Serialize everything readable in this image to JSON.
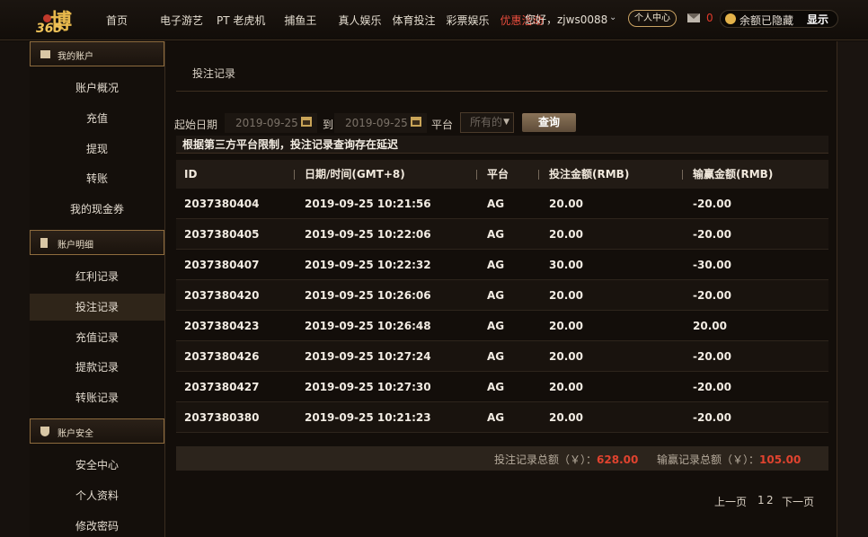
{
  "header": {
    "logo_text": "博",
    "logo_number": "365",
    "nav": [
      "首页",
      "电子游艺",
      "PT 老虎机",
      "捕鱼王",
      "真人娱乐",
      "体育投注",
      "彩票娱乐",
      "优惠活动"
    ],
    "greeting": "您好，zjws0088",
    "personal_center": "个人中心",
    "mail_count": "0",
    "balance_hidden": "余额已隐藏",
    "show_label": "显示"
  },
  "sidebar": {
    "sections": [
      {
        "title": "我的账户",
        "items": [
          "账户概况",
          "充值",
          "提现",
          "转账",
          "我的现金券"
        ]
      },
      {
        "title": "账户明细",
        "items": [
          "红利记录",
          "投注记录",
          "充值记录",
          "提款记录",
          "转账记录"
        ]
      },
      {
        "title": "账户安全",
        "items": [
          "安全中心",
          "个人资料",
          "修改密码"
        ]
      }
    ],
    "active": "投注记录"
  },
  "main": {
    "page_title": "投注记录",
    "filter": {
      "start_label": "起始日期",
      "start_value": "2019-09-25",
      "to_label": "到",
      "end_value": "2019-09-25",
      "platform_label": "平台",
      "platform_value": "所有的",
      "query_label": "查询"
    },
    "notice": "根据第三方平台限制，投注记录查询存在延迟",
    "table": {
      "columns": [
        "ID",
        "日期/时间(GMT+8)",
        "平台",
        "投注金额(RMB)",
        "输赢金额(RMB)"
      ],
      "rows": [
        [
          "2037380404",
          "2019-09-25 10:21:56",
          "AG",
          "20.00",
          "-20.00"
        ],
        [
          "2037380405",
          "2019-09-25 10:22:06",
          "AG",
          "20.00",
          "-20.00"
        ],
        [
          "2037380407",
          "2019-09-25 10:22:32",
          "AG",
          "30.00",
          "-30.00"
        ],
        [
          "2037380420",
          "2019-09-25 10:26:06",
          "AG",
          "20.00",
          "-20.00"
        ],
        [
          "2037380423",
          "2019-09-25 10:26:48",
          "AG",
          "20.00",
          "20.00"
        ],
        [
          "2037380426",
          "2019-09-25 10:27:24",
          "AG",
          "20.00",
          "-20.00"
        ],
        [
          "2037380427",
          "2019-09-25 10:27:30",
          "AG",
          "20.00",
          "-20.00"
        ],
        [
          "2037380380",
          "2019-09-25 10:21:23",
          "AG",
          "20.00",
          "-20.00"
        ]
      ]
    },
    "summary": {
      "bet_label": "投注记录总额（￥）：",
      "bet_total": "628.00",
      "win_label": "输赢记录总额（￥）：",
      "win_total": "105.00"
    },
    "pager": {
      "prev": "上一页",
      "page1": "1",
      "page2": "2",
      "next": "下一页"
    }
  },
  "colors": {
    "accent_gold": "#c9a262",
    "promo_red": "#e84c3d",
    "total_red": "#e0432f"
  }
}
